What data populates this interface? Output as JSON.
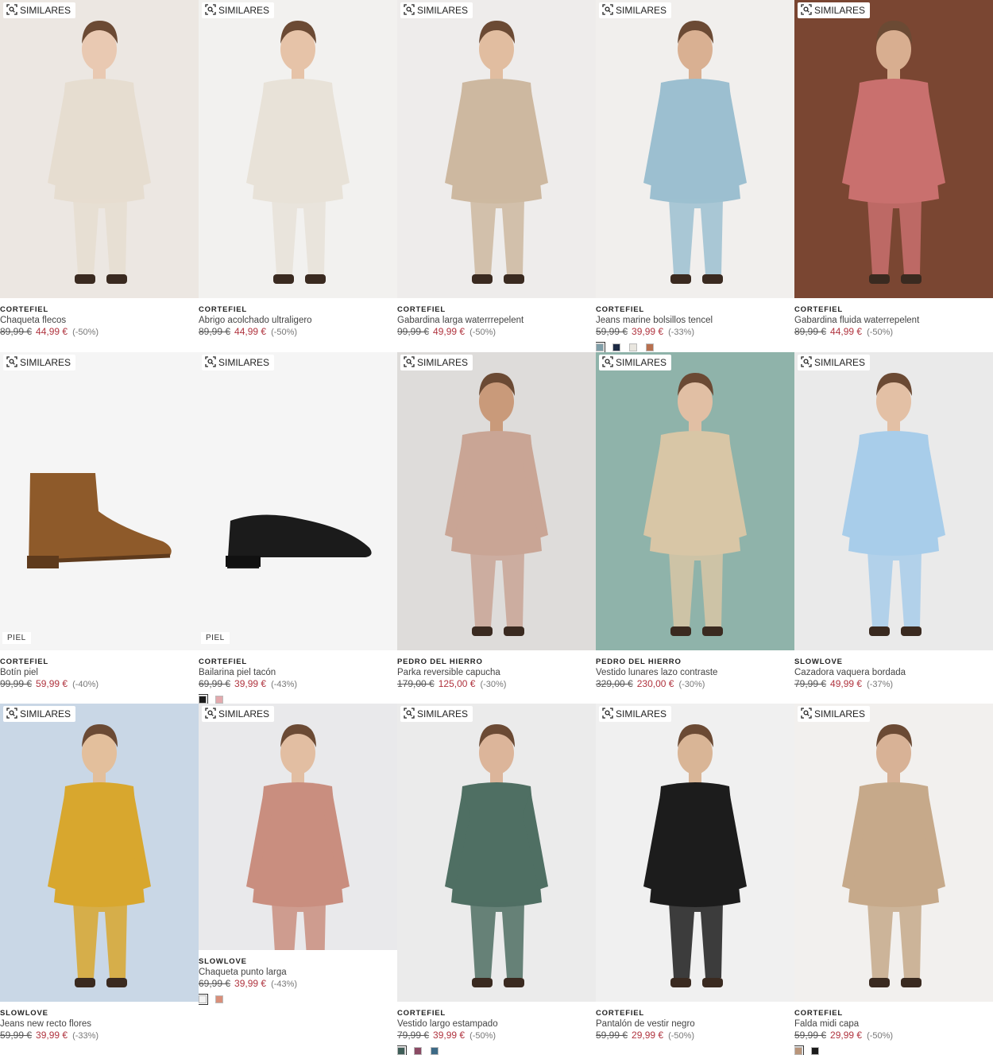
{
  "similar_label": "SIMILARES",
  "piel_label": "PIEL",
  "rows": [
    [
      {
        "brand": "CORTEFIEL",
        "name": "Chaqueta flecos",
        "old": "89,99 €",
        "new": "44,99 €",
        "disc": "(-50%)",
        "bg": "#ece7e2",
        "garment": "#e6ddd0",
        "skin": "#e9c9b2",
        "swatches": []
      },
      {
        "brand": "CORTEFIEL",
        "name": "Abrigo acolchado ultraligero",
        "old": "89,99 €",
        "new": "44,99 €",
        "disc": "(-50%)",
        "bg": "#f2f1ef",
        "garment": "#e8e2d8",
        "skin": "#e6c3a8",
        "swatches": []
      },
      {
        "brand": "CORTEFIEL",
        "name": "Gabardina larga waterrrepelent",
        "old": "99,99 €",
        "new": "49,99 €",
        "disc": "(-50%)",
        "bg": "#eeeceb",
        "garment": "#cdb8a0",
        "skin": "#e1bda0",
        "swatches": []
      },
      {
        "brand": "CORTEFIEL",
        "name": "Jeans marine bolsillos tencel",
        "old": "59,99 €",
        "new": "39,99 €",
        "disc": "(-33%)",
        "bg": "#f1efed",
        "garment": "#9cbfd0",
        "skin": "#d9b092",
        "swatches": [
          "#7f9ea8",
          "#1c2a44",
          "#e9e6df",
          "#b8704f"
        ]
      },
      {
        "brand": "CORTEFIEL",
        "name": "Gabardina fluida waterrepelent",
        "old": "89,99 €",
        "new": "44,99 €",
        "disc": "(-50%)",
        "bg": "#7a4632",
        "garment": "#c9706e",
        "skin": "#d8ae90",
        "swatches": []
      }
    ],
    [
      {
        "brand": "CORTEFIEL",
        "name": "Botín piel",
        "old": "99,99 €",
        "new": "59,99 €",
        "disc": "(-40%)",
        "bg": "#f5f5f5",
        "garment": "#8e5a2a",
        "skin": "",
        "piel": true,
        "swatches": []
      },
      {
        "brand": "CORTEFIEL",
        "name": "Bailarina piel tacón",
        "old": "69,99 €",
        "new": "39,99 €",
        "disc": "(-43%)",
        "bg": "#f5f5f5",
        "garment": "#1b1b1b",
        "skin": "",
        "piel": true,
        "swatches": [
          "#1b1b1b",
          "#e3a9ad"
        ]
      },
      {
        "brand": "PEDRO DEL HIERRO",
        "name": "Parka reversible capucha",
        "old": "179,00 €",
        "new": "125,00 €",
        "disc": "(-30%)",
        "bg": "#dedcda",
        "garment": "#c9a595",
        "skin": "#c99a7a",
        "swatches": []
      },
      {
        "brand": "PEDRO DEL HIERRO",
        "name": "Vestido lunares lazo contraste",
        "old": "329,00 €",
        "new": "230,00 €",
        "disc": "(-30%)",
        "bg": "#8fb3aa",
        "garment": "#d8c6a6",
        "skin": "#e1bfa4",
        "swatches": []
      },
      {
        "brand": "SLOWLOVE",
        "name": "Cazadora vaquera bordada",
        "old": "79,99 €",
        "new": "49,99 €",
        "disc": "(-37%)",
        "bg": "#eaeaea",
        "garment": "#a8cdea",
        "skin": "#e3c0a5",
        "swatches": []
      }
    ],
    [
      {
        "brand": "SLOWLOVE",
        "name": "Jeans new recto flores",
        "old": "59,99 €",
        "new": "39,99 €",
        "disc": "(-33%)",
        "bg": "#c9d7e6",
        "garment": "#d8a72e",
        "skin": "#e3bf9c",
        "swatches": []
      },
      {
        "brand": "SLOWLOVE",
        "name": "Chaqueta punto larga",
        "old": "69,99 €",
        "new": "39,99 €",
        "disc": "(-43%)",
        "bg": "#e9e9eb",
        "garment": "#c98e7f",
        "skin": "#e2bea2",
        "swatches": [
          "#f2f2f2",
          "#d98f7a"
        ]
      },
      {
        "brand": "CORTEFIEL",
        "name": "Vestido largo estampado",
        "old": "79,99 €",
        "new": "39,99 €",
        "disc": "(-50%)",
        "bg": "#ebebeb",
        "garment": "#4f6f63",
        "skin": "#dcb59a",
        "swatches": [
          "#3f5e58",
          "#8b4a64",
          "#3d6a86"
        ]
      },
      {
        "brand": "CORTEFIEL",
        "name": "Pantalón de vestir negro",
        "old": "59,99 €",
        "new": "29,99 €",
        "disc": "(-50%)",
        "bg": "#f0f0f0",
        "garment": "#1c1c1c",
        "skin": "#d9b596",
        "swatches": []
      },
      {
        "brand": "CORTEFIEL",
        "name": "Falda midi capa",
        "old": "59,99 €",
        "new": "29,99 €",
        "disc": "(-50%)",
        "bg": "#f2f0ee",
        "garment": "#c6a98a",
        "skin": "#d8b296",
        "swatches": [
          "#b9957a",
          "#1b1b1b"
        ]
      }
    ]
  ]
}
